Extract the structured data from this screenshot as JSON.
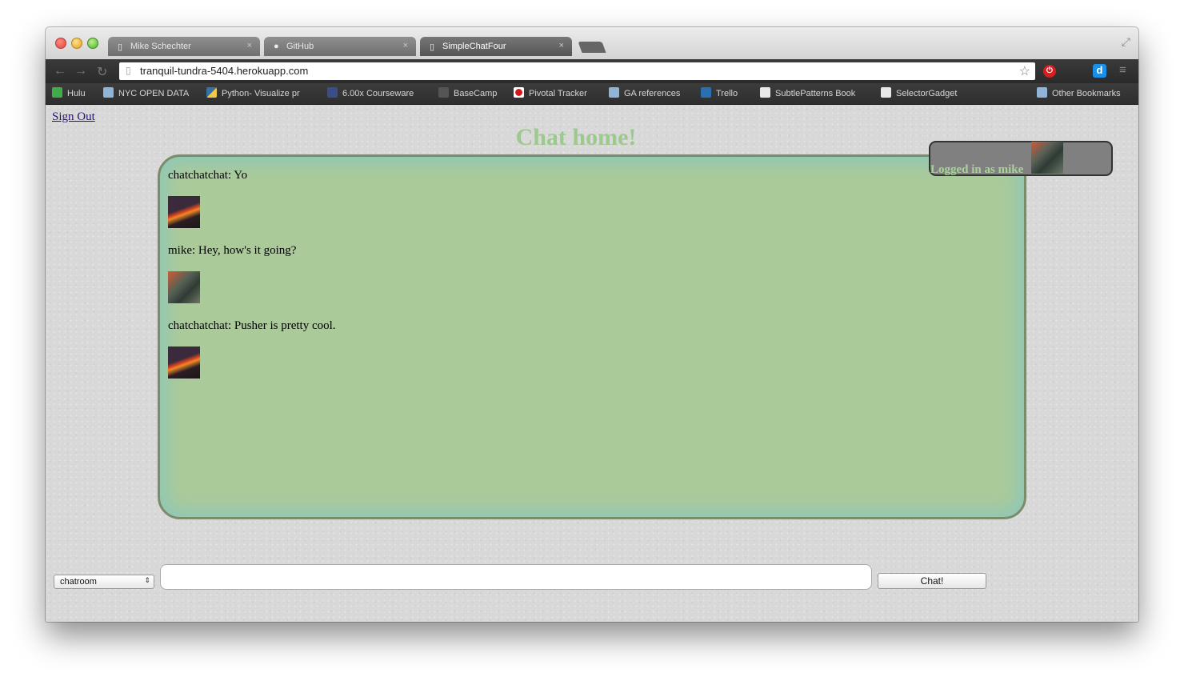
{
  "browser": {
    "tabs": [
      {
        "label": "Mike Schechter",
        "icon": "page-icon"
      },
      {
        "label": "GitHub",
        "icon": "github-icon"
      },
      {
        "label": "SimpleChatFour",
        "icon": "page-icon"
      }
    ],
    "url": "tranquil-tundra-5404.herokuapp.com",
    "bookmarks": [
      {
        "label": "Hulu",
        "icon": "hulu-icon"
      },
      {
        "label": "NYC OPEN DATA",
        "icon": "folder-icon"
      },
      {
        "label": "Python- Visualize pr",
        "icon": "python-icon"
      },
      {
        "label": "6.00x Courseware",
        "icon": "edx-icon"
      },
      {
        "label": "BaseCamp",
        "icon": "basecamp-icon"
      },
      {
        "label": "Pivotal Tracker",
        "icon": "pivotal-icon"
      },
      {
        "label": "GA references",
        "icon": "folder-icon"
      },
      {
        "label": "Trello",
        "icon": "trello-icon"
      },
      {
        "label": "SubtlePatterns Book",
        "icon": "page-icon"
      },
      {
        "label": "SelectorGadget",
        "icon": "page-icon"
      },
      {
        "label": "Other Bookmarks",
        "icon": "folder-icon"
      }
    ]
  },
  "page": {
    "sign_out": "Sign Out",
    "title": "Chat home!",
    "logged_in": "Logged in as mike",
    "messages": [
      {
        "text": "chatchatchat: Yo",
        "avatar": "volcano"
      },
      {
        "text": "mike: Hey, how's it going?",
        "avatar": "water"
      },
      {
        "text": "chatchatchat: Pusher is pretty cool.",
        "avatar": "volcano"
      }
    ],
    "room_select_value": "chatroom",
    "message_input_value": "",
    "chat_button": "Chat!"
  },
  "colors": {
    "title": "#9ec98e",
    "chatbox_bg": "#aaca9a",
    "chatbox_border": "#7a8c6a",
    "login_box_bg": "#808080"
  }
}
